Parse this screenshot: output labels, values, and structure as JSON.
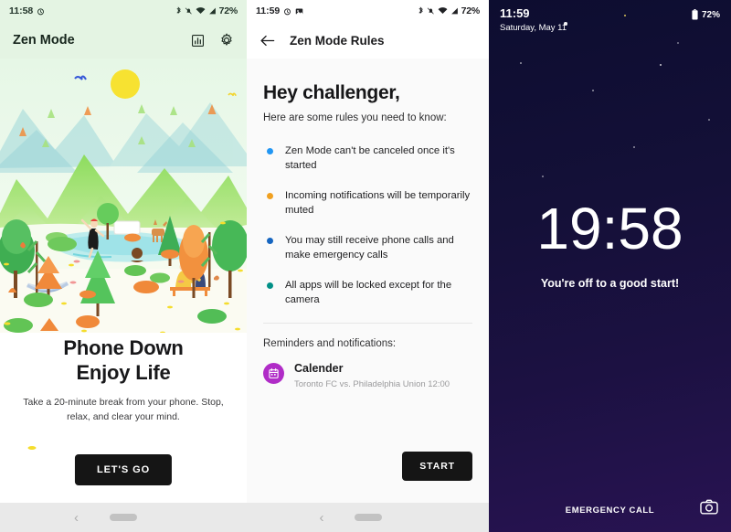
{
  "panel1": {
    "status_bar": {
      "time": "11:58",
      "battery_percent": "72%",
      "icons": [
        "alarm-icon",
        "bluetooth-icon",
        "notifications-muted-icon",
        "wifi-icon",
        "signal-icon"
      ]
    },
    "app_bar": {
      "title": "Zen Mode",
      "actions": [
        "stats-icon",
        "gear-icon"
      ]
    },
    "illustration": {
      "name": "zen-forest-illustration",
      "sky_color": "#e8f7e8",
      "sun_color": "#f7e231",
      "mountain_color": "#8fd86a"
    },
    "headline_line1": "Phone Down",
    "headline_line2": "Enjoy Life",
    "subtext": "Take a 20-minute break from your phone. Stop, relax, and clear your mind.",
    "primary_button": "LET'S GO",
    "nav_bar": {
      "back": "back-icon",
      "home": "home-pill"
    }
  },
  "panel2": {
    "status_bar": {
      "time": "11:59",
      "battery_percent": "72%",
      "icons": [
        "alarm-icon",
        "screenshot-icon",
        "bluetooth-icon",
        "notifications-muted-icon",
        "wifi-icon",
        "signal-icon"
      ]
    },
    "app_bar": {
      "back": "back-arrow-icon",
      "title": "Zen Mode Rules"
    },
    "heading": "Hey challenger,",
    "lead": "Here are some rules you need to know:",
    "rules": [
      {
        "text": "Zen Mode can't be canceled once it's started",
        "dot_color": "#2196f3"
      },
      {
        "text": "Incoming notifications will be temporarily muted",
        "dot_color": "#f0a020"
      },
      {
        "text": "You may still receive phone calls and make emergency calls",
        "dot_color": "#1565c0"
      },
      {
        "text": "All apps will be locked except for the camera",
        "dot_color": "#019087"
      }
    ],
    "reminders_title": "Reminders and notifications:",
    "notification": {
      "icon": "calendar-icon",
      "icon_color": "#b02cc7",
      "app_name": "Calender",
      "detail": "Toronto FC vs. Philadelphia Union 12:00"
    },
    "primary_button": "START",
    "nav_bar": {
      "back": "back-icon",
      "home": "home-pill"
    }
  },
  "panel3": {
    "status_bar": {
      "time": "11:59",
      "date": "Saturday, May 11",
      "battery_percent": "72%",
      "battery_icon": "battery-icon"
    },
    "countdown": "19:58",
    "encouragement": "You're off to a good start!",
    "emergency_call": "EMERGENCY CALL",
    "camera_icon": "camera-icon",
    "background_top": "#0d0d30",
    "background_bottom": "#281352"
  }
}
